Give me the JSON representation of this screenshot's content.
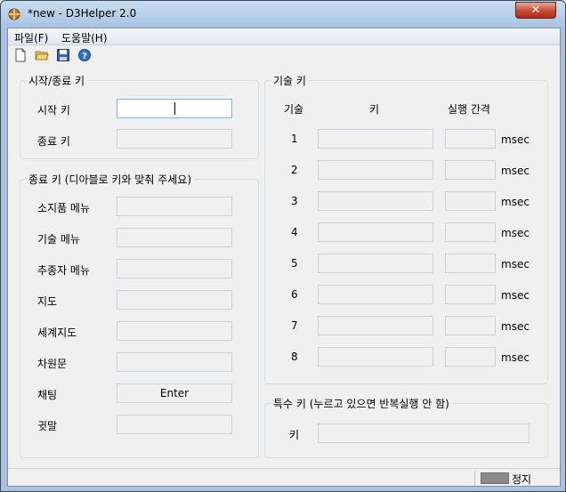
{
  "window": {
    "title": "*new - D3Helper 2.0",
    "close_label": "✕"
  },
  "menu": {
    "items": [
      "파일(F)",
      "도움말(H)"
    ]
  },
  "toolbar": {
    "icons": [
      "new-file-icon",
      "open-folder-icon",
      "save-icon",
      "help-icon"
    ]
  },
  "start_stop": {
    "title": "시작/종료 키",
    "start_label": "시작 키",
    "stop_label": "종료 키"
  },
  "game_keys": {
    "title": "종료 키 (디아블로 키와 맞춰 주세요)",
    "rows": [
      {
        "label": "소지품 메뉴",
        "value": ""
      },
      {
        "label": "기술 메뉴",
        "value": ""
      },
      {
        "label": "추종자 메뉴",
        "value": ""
      },
      {
        "label": "지도",
        "value": ""
      },
      {
        "label": "세계지도",
        "value": ""
      },
      {
        "label": "차원문",
        "value": ""
      },
      {
        "label": "채팅",
        "value": "Enter"
      },
      {
        "label": "귓말",
        "value": ""
      }
    ]
  },
  "skill_keys": {
    "title": "기술 키",
    "col_skill": "기술",
    "col_key": "키",
    "col_interval": "실행 간격",
    "unit": "msec",
    "rows": [
      "1",
      "2",
      "3",
      "4",
      "5",
      "6",
      "7",
      "8"
    ]
  },
  "special_key": {
    "title": "특수 키 (누르고 있으면 반복실행 안 함)",
    "key_label": "키"
  },
  "status": {
    "text": "정지"
  }
}
